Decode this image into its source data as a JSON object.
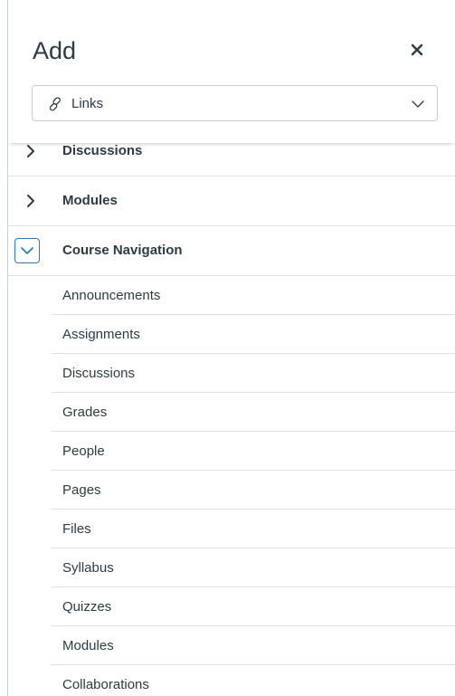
{
  "header": {
    "title": "Add",
    "close_label": "×"
  },
  "select": {
    "value": "Links",
    "icon": "link-icon"
  },
  "groups": {
    "discussions": {
      "label": "Discussions",
      "state": "collapsed"
    },
    "modules": {
      "label": "Modules",
      "state": "collapsed"
    },
    "course_navigation": {
      "label": "Course Navigation",
      "state": "expanded"
    }
  },
  "course_navigation_items": [
    "Announcements",
    "Assignments",
    "Discussions",
    "Grades",
    "People",
    "Pages",
    "Files",
    "Syllabus",
    "Quizzes",
    "Modules",
    "Collaborations"
  ],
  "colors": {
    "text": "#2d3b45",
    "accent": "#2b7abc",
    "border": "#c7cdd1",
    "divider": "#dde2e5"
  }
}
